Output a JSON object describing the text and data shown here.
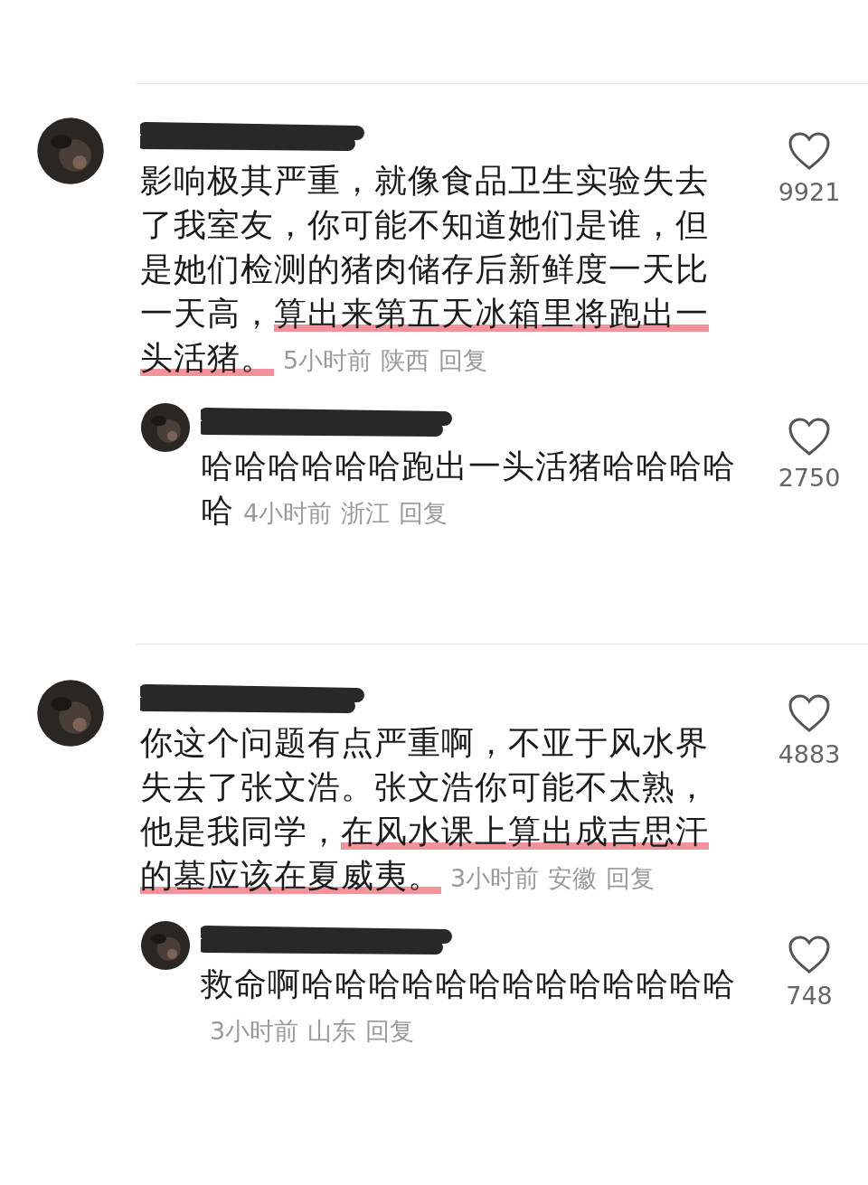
{
  "comments": [
    {
      "name_redacted": true,
      "segments": [
        {
          "text": "影响极其严重，就像食品卫生实验失去了我室友，你可能不知道她们是谁，但是她们检测的猪肉储存后新鲜度一天比一天高，",
          "highlighted": false
        },
        {
          "text": "算出来第五天冰箱里将跑出一头活猪。",
          "highlighted": true
        }
      ],
      "time": "5小时前",
      "location": "陕西",
      "reply_label": "回复",
      "liked": false,
      "likes": "9921",
      "replies": [
        {
          "name_redacted": true,
          "segments": [
            {
              "text": "哈哈哈哈哈哈跑出一头活猪哈哈哈哈哈",
              "highlighted": false
            }
          ],
          "time": "4小时前",
          "location": "浙江",
          "reply_label": "回复",
          "liked": false,
          "likes": "2750"
        }
      ]
    },
    {
      "name_redacted": true,
      "segments": [
        {
          "text": "你这个问题有点严重啊，不亚于风水界失去了张文浩。张文浩你可能不太熟，他是我同学，",
          "highlighted": false
        },
        {
          "text": "在风水课上算出成吉思汗的墓应该在夏威夷。",
          "highlighted": true
        }
      ],
      "time": "3小时前",
      "location": "安徽",
      "reply_label": "回复",
      "liked": false,
      "likes": "4883",
      "replies": [
        {
          "name_redacted": true,
          "segments": [
            {
              "text": "救命啊哈哈哈哈哈哈哈哈哈哈哈哈哈",
              "highlighted": false
            }
          ],
          "time": "3小时前",
          "location": "山东",
          "reply_label": "回复",
          "liked": false,
          "likes": "748"
        }
      ]
    }
  ]
}
